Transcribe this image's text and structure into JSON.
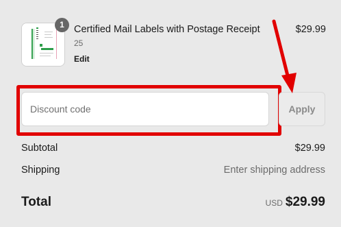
{
  "cart": {
    "item": {
      "quantity": "1",
      "title": "Certified Mail Labels with Postage Receipt",
      "variant": "25",
      "edit_label": "Edit",
      "price": "$29.99",
      "thumbnail_icon": "label-sheet-thumbnail-icon"
    }
  },
  "discount": {
    "placeholder": "Discount code",
    "value": "",
    "apply_label": "Apply"
  },
  "summary": {
    "subtotal_label": "Subtotal",
    "subtotal_value": "$29.99",
    "shipping_label": "Shipping",
    "shipping_value": "Enter shipping address",
    "total_label": "Total",
    "currency": "USD",
    "total_value": "$29.99"
  },
  "colors": {
    "background": "#e9e9e9",
    "annotation_red": "#e10000",
    "badge": "#666666",
    "thumbnail_green": "#2e9e4b"
  }
}
